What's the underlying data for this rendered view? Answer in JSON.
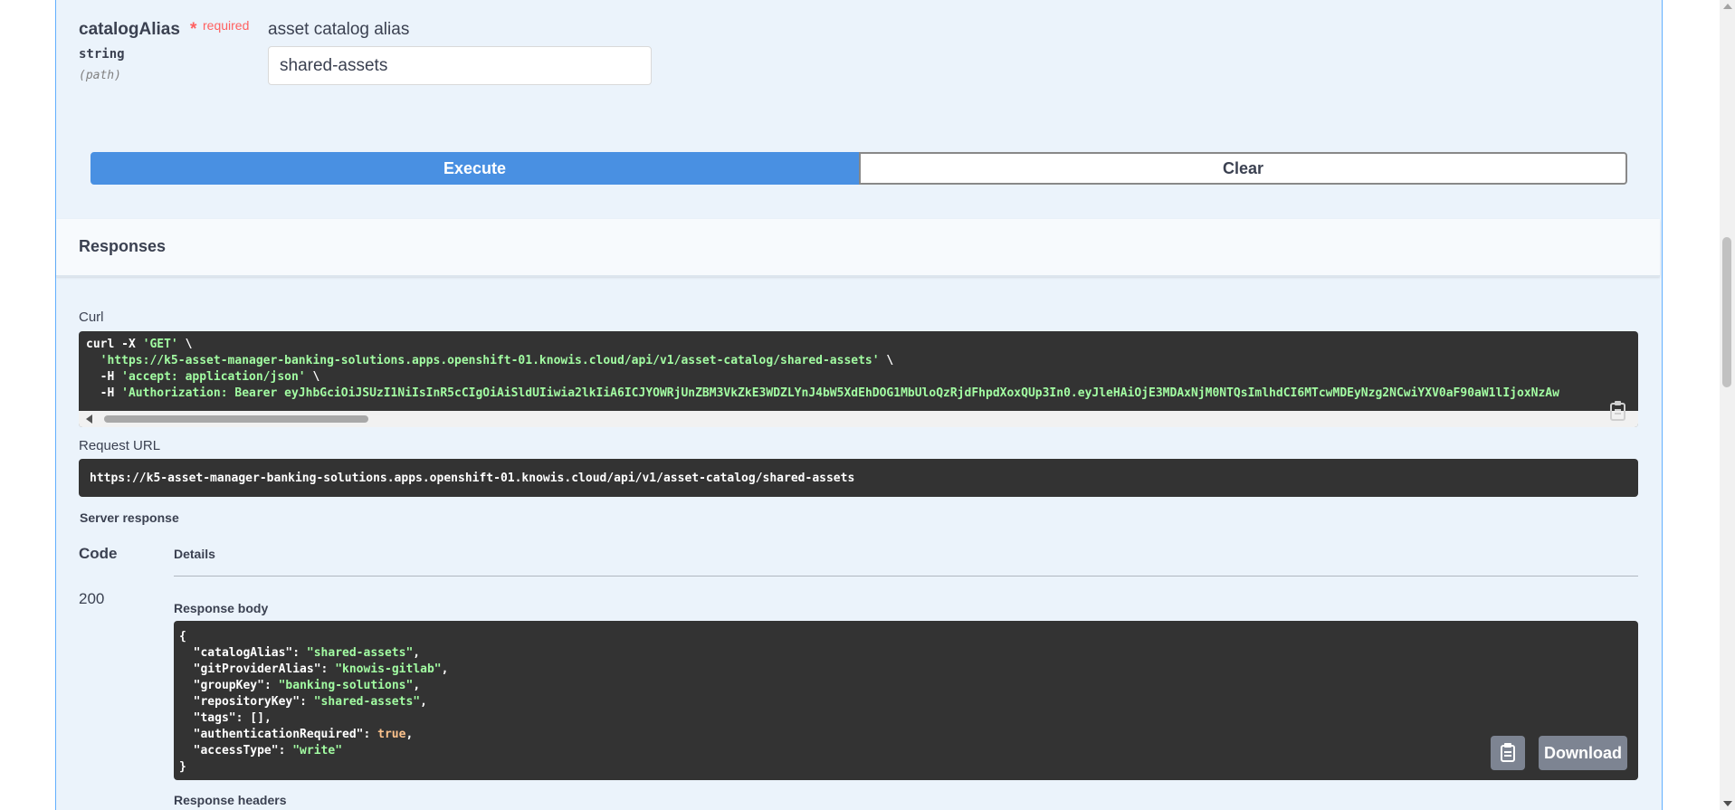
{
  "parameter": {
    "name": "catalogAlias",
    "star": "*",
    "required_label": "required",
    "type": "string",
    "location": "(path)",
    "description": "asset catalog alias",
    "value": "shared-assets"
  },
  "buttons": {
    "execute": "Execute",
    "clear": "Clear"
  },
  "responses": {
    "title": "Responses",
    "curl_label": "Curl",
    "curl": {
      "l1_a": "curl -X ",
      "l1_b": "'GET'",
      "l1_c": " \\",
      "l2_a": "  ",
      "l2_b": "'https://k5-asset-manager-banking-solutions.apps.openshift-01.knowis.cloud/api/v1/asset-catalog/shared-assets'",
      "l2_c": " \\",
      "l3_a": "  -H ",
      "l3_b": "'accept: application/json'",
      "l3_c": " \\",
      "l4_a": "  -H ",
      "l4_b": "'Authorization: Bearer eyJhbGciOiJSUzI1NiIsInR5cCIgOiAiSldUIiwia2lkIiA6ICJYOWRjUnZBM3VkZkE3WDZLYnJ4bW5XdEhDOG1MbUloQzRjdFhpdXoxQUp3In0.eyJleHAiOjE3MDAxNjM0NTQsImlhdCI6MTcwMDEyNzg2NCwiYXV0aF90aW1lIjoxNzAw"
    },
    "request_url_label": "Request URL",
    "request_url": "https://k5-asset-manager-banking-solutions.apps.openshift-01.knowis.cloud/api/v1/asset-catalog/shared-assets",
    "server_response_label": "Server response",
    "code_header": "Code",
    "details_header": "Details",
    "status_code": "200",
    "response_body_label": "Response body",
    "response_headers_label": "Response headers",
    "body": {
      "open": "{",
      "close": "}",
      "k1": "\"catalogAlias\"",
      "v1": "\"shared-assets\"",
      "k2": "\"gitProviderAlias\"",
      "v2": "\"knowis-gitlab\"",
      "k3": "\"groupKey\"",
      "v3": "\"banking-solutions\"",
      "k4": "\"repositoryKey\"",
      "v4": "\"shared-assets\"",
      "k5": "\"tags\"",
      "v5": "[]",
      "k6": "\"authenticationRequired\"",
      "v6": "true",
      "k7": "\"accessType\"",
      "v7": "\"write\""
    },
    "download_label": "Download"
  }
}
